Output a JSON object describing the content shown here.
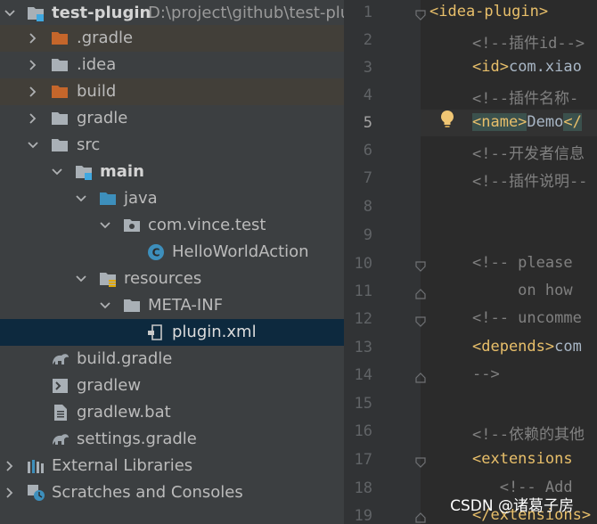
{
  "project_tree": {
    "root": {
      "name": "test-plugin",
      "path": "D:\\project\\github\\test-plu"
    },
    "items": [
      {
        "label": ".gradle"
      },
      {
        "label": ".idea"
      },
      {
        "label": "build"
      },
      {
        "label": "gradle"
      },
      {
        "label": "src"
      },
      {
        "label": "main"
      },
      {
        "label": "java"
      },
      {
        "label": "com.vince.test"
      },
      {
        "label": "HelloWorldAction"
      },
      {
        "label": "resources"
      },
      {
        "label": "META-INF"
      },
      {
        "label": "plugin.xml"
      },
      {
        "label": "build.gradle"
      },
      {
        "label": "gradlew"
      },
      {
        "label": "gradlew.bat"
      },
      {
        "label": "settings.gradle"
      },
      {
        "label": "External Libraries"
      },
      {
        "label": "Scratches and Consoles"
      }
    ]
  },
  "editor": {
    "line_numbers": [
      "1",
      "2",
      "3",
      "4",
      "5",
      "6",
      "7",
      "8",
      "9",
      "10",
      "11",
      "12",
      "13",
      "14",
      "15",
      "16",
      "17",
      "18",
      "19"
    ],
    "current_line": "5",
    "lines": {
      "l1": "<idea-plugin>",
      "l2": "<!--插件id-->",
      "l3_open": "<id>",
      "l3_text": "com.xiao",
      "l4": "<!--插件名称-",
      "l5_open": "<name>",
      "l5_text": "Demo",
      "l5_close": "</",
      "l6": "<!--开发者信息",
      "l7": "<!--插件说明--",
      "l10": "<!-- please ",
      "l11": "     on how ",
      "l12": "<!-- uncomme",
      "l13_open": "<depends>",
      "l13_text": "com",
      "l14": "-->",
      "l16": "<!--依赖的其他",
      "l17": "<extensions ",
      "l18": "   <!-- Add",
      "l19": "</extensions>"
    }
  },
  "watermark": "CSDN @诸葛子房",
  "colors": {
    "tree_bg": "#3c3f41",
    "editor_bg": "#2b2b2b",
    "selection": "#0d293e",
    "tag": "#e8bf6a",
    "comment": "#808080",
    "folder_excluded": "#c5662b",
    "folder": "#a9b0b6",
    "folder_source": "#3d8fbc"
  }
}
